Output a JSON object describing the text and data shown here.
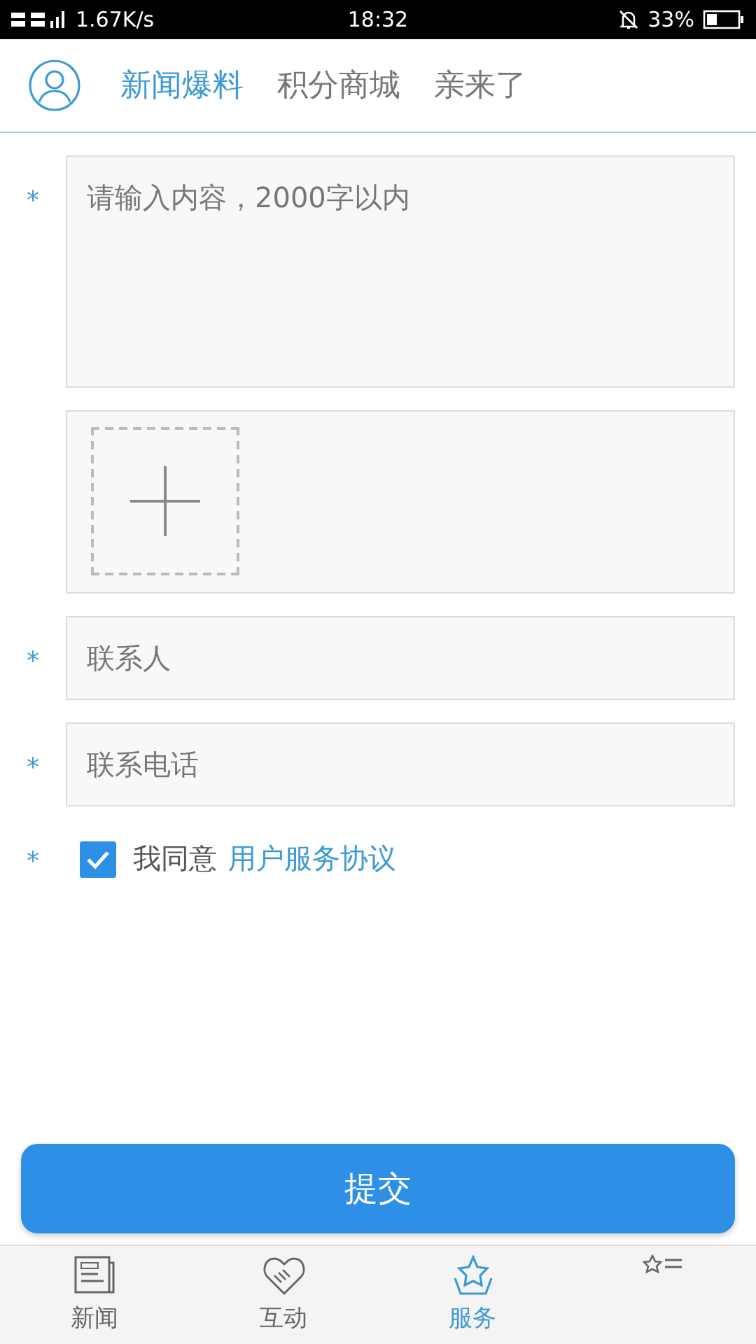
{
  "status_bar": {
    "network": "1.67K/s",
    "time": "18:32",
    "battery": "33%"
  },
  "header": {
    "tabs": [
      {
        "label": "新闻爆料",
        "selected": true
      },
      {
        "label": "积分商城",
        "selected": false
      },
      {
        "label": "亲来了",
        "selected": false
      }
    ]
  },
  "form": {
    "content": {
      "required_mark": "*",
      "placeholder": "请输入内容，2000字以内"
    },
    "contact": {
      "required_mark": "*",
      "placeholder": "联系人"
    },
    "phone": {
      "required_mark": "*",
      "placeholder": "联系电话"
    },
    "agreement": {
      "required_mark": "*",
      "checked": true,
      "text": "我同意",
      "link": "用户服务协议"
    }
  },
  "submit": "提交",
  "bottom_nav": [
    {
      "kind": "news",
      "label": "新闻",
      "selected": false
    },
    {
      "kind": "interact",
      "label": "互动",
      "selected": false
    },
    {
      "kind": "service",
      "label": "服务",
      "selected": true
    },
    {
      "kind": "list",
      "selected": false
    }
  ]
}
